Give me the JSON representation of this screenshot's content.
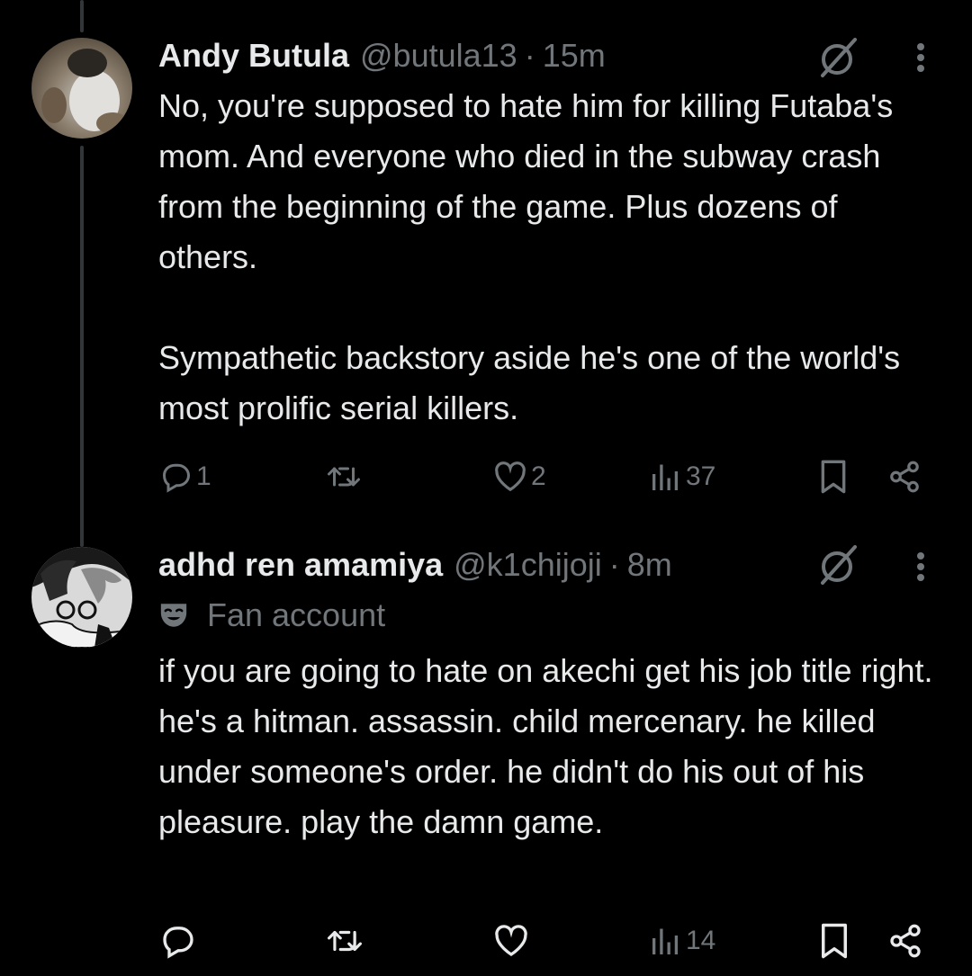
{
  "tweets": [
    {
      "name": "Andy Butula",
      "handle": "@butula13",
      "dot": "·",
      "time": "15m",
      "text": "No, you're supposed to hate him for killing Futaba's mom. And everyone who died in the subway crash from the beginning of the game. Plus dozens of others.\n\nSympathetic backstory aside he's one of the world's most prolific serial killers.",
      "replies": "1",
      "reposts": "",
      "likes": "2",
      "views": "37"
    },
    {
      "name": "adhd ren amamiya",
      "handle": "@k1chijoji",
      "dot": "·",
      "time": "8m",
      "badge": "Fan account",
      "text": "if you are going to hate on akechi get his job title right. he's a hitman. assassin. child mercenary. he killed under someone's order. he didn't do his out of his pleasure. play the damn game.",
      "replies": "",
      "reposts": "",
      "likes": "",
      "views": "14"
    }
  ],
  "icons": [
    "reply-icon",
    "repost-icon",
    "like-icon",
    "views-icon",
    "bookmark-icon",
    "share-icon",
    "grok-icon",
    "more-icon",
    "mask-icon"
  ],
  "colors": {
    "background": "#000000",
    "text": "#e7e9ea",
    "muted": "#71767b",
    "thread_line": "#333639"
  }
}
